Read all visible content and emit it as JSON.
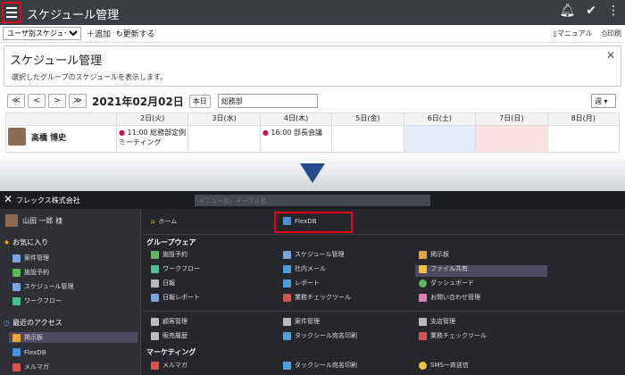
{
  "app": {
    "title": "スケジュール管理",
    "top_icons": [
      "bell-icon",
      "check-icon",
      "more-icon"
    ]
  },
  "toolbar": {
    "view_select": "ユーザ別スケジュール",
    "add_label": "追加",
    "refresh_label": "更新する",
    "manual_label": "マニュアル",
    "print_label": "印刷"
  },
  "panel": {
    "title": "スケジュール管理",
    "description": "選択したグループのスケジュールを表示します。"
  },
  "nav": {
    "buttons": [
      "≪",
      "<",
      ">",
      "≫"
    ],
    "current_date": "2021年02月02日",
    "today_label": "本日",
    "group": "総務部",
    "range": "週"
  },
  "schedule": {
    "days": [
      "2日(火)",
      "3日(水)",
      "4日(木)",
      "5日(金)",
      "6日(土)",
      "7日(日)",
      "8日(月)"
    ],
    "user": "高橋 博史",
    "events": {
      "tue": "11:00 総務部定例ミーティング",
      "thu": "16:00 部長会議"
    }
  },
  "menu": {
    "company": "フレックス株式会社",
    "search_placeholder": "メニュー名、テーブル名",
    "user": "山田 一郎 様",
    "favorites_label": "お気に入り",
    "favorites": [
      "案件管理",
      "施設予約",
      "スケジュール管理",
      "ワークフロー"
    ],
    "recent_label": "最近のアクセス",
    "recent": [
      "掲示板",
      "FlexDB",
      "メルマガ"
    ],
    "home": "ホーム",
    "flexdb": "FlexDB",
    "groupware_label": "グループウェア",
    "groupware": {
      "col1": [
        "施設予約",
        "ワークフロー",
        "日報",
        "日報レポート"
      ],
      "col2": [
        "スケジュール管理",
        "社内メール",
        "レポート",
        "業務チェックツール"
      ],
      "col3": [
        "掲示板",
        "ファイル共有",
        "ダッシュボード",
        "お問い合わせ管理"
      ]
    },
    "crm": {
      "col1": [
        "顧客管理",
        "販売履歴"
      ],
      "col2": [
        "案件管理",
        "タックシール宛名印刷"
      ],
      "col3": [
        "支店管理",
        "業務チェックツール"
      ]
    },
    "marketing_label": "マーケティング",
    "marketing": [
      "メルマガ",
      "タックシール宛名印刷",
      "SMS一斉送信"
    ]
  },
  "colors": {
    "topbar": "#3a3d42",
    "highlight_red": "#e8001c",
    "arrow_blue": "#274a8e",
    "menu_bg": "#25272c"
  }
}
